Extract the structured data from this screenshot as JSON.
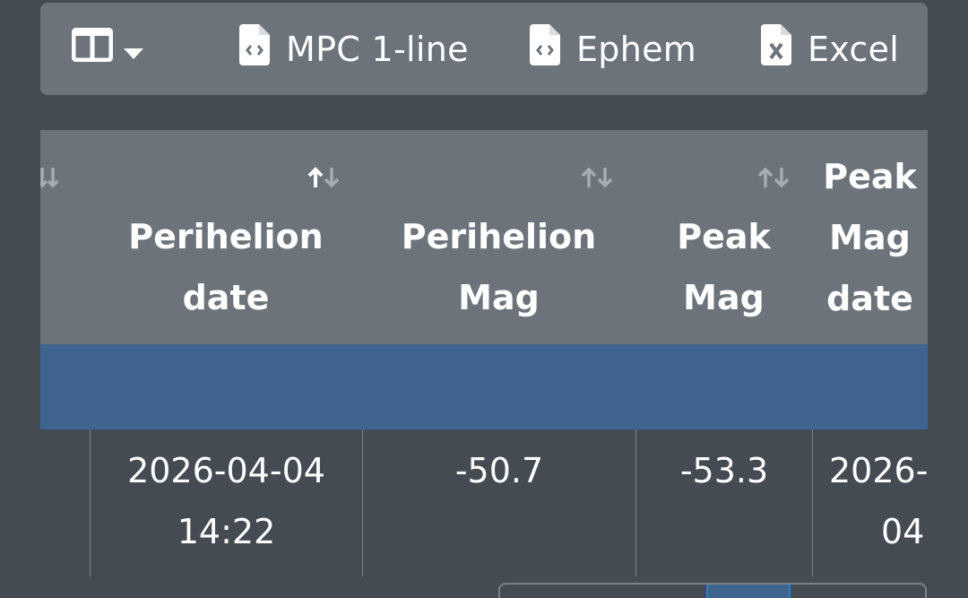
{
  "toolbar": {
    "column_toggle_icon": "columns-icon",
    "dropdown_icon": "caret-down-icon",
    "buttons": [
      {
        "label": "MPC 1-line",
        "icon": "file-code-icon"
      },
      {
        "label": "Ephem",
        "icon": "file-code-icon"
      },
      {
        "label": "Excel",
        "icon": "file-excel-icon"
      }
    ]
  },
  "table": {
    "headers": [
      {
        "line1": "Perihelion",
        "line2": "date"
      },
      {
        "line1": "Perihelion",
        "line2": "Mag"
      },
      {
        "line1": "Peak",
        "line2": "Mag"
      },
      {
        "line1": "Peak",
        "line2": "Mag",
        "line3": "date"
      }
    ],
    "rows": [
      {
        "cells": [
          {
            "line1": "2026-04-04",
            "line2": "14:22"
          },
          {
            "line1": "-50.7",
            "line2": ""
          },
          {
            "line1": "-53.3",
            "line2": ""
          },
          {
            "line1": "2026-04-",
            "line2": "04"
          }
        ]
      }
    ]
  },
  "colors": {
    "page_bg": "#454b53",
    "header_bg": "#6c737b",
    "filter_row_bg": "#3f6490",
    "text": "#ffffff"
  }
}
